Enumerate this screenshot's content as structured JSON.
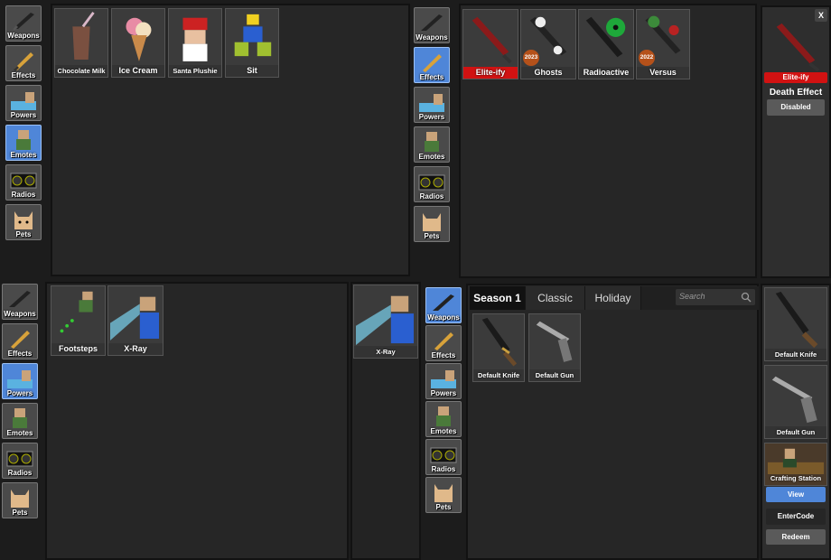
{
  "sidebar_labels": {
    "weapons": "Weapons",
    "effects": "Effects",
    "powers": "Powers",
    "emotes": "Emotes",
    "radios": "Radios",
    "pets": "Pets"
  },
  "emotes_panel": {
    "items": [
      "Chocolate Milk",
      "Ice Cream",
      "Santa Plushie",
      "Sit"
    ]
  },
  "effects_panel": {
    "items": [
      {
        "name": "Elite-ify",
        "badge": ""
      },
      {
        "name": "Ghosts",
        "badge": "2023"
      },
      {
        "name": "Radioactive",
        "badge": ""
      },
      {
        "name": "Versus",
        "badge": "2022"
      }
    ]
  },
  "effect_detail": {
    "close_label": "X",
    "item_name": "Elite-ify",
    "section_title": "Death Effect",
    "toggle_label": "Disabled"
  },
  "powers_panel": {
    "items": [
      "Footsteps",
      "X-Ray"
    ],
    "preview_label": "X-Ray"
  },
  "weapons_panel": {
    "tabs": [
      "Season 1",
      "Classic",
      "Holiday"
    ],
    "active_tab": "Season 1",
    "search_placeholder": "Search",
    "items": [
      "Default Knife",
      "Default Gun"
    ]
  },
  "weapon_detail": {
    "knife_label": "Default Knife",
    "gun_label": "Default Gun",
    "crafting_label": "Crafting Station",
    "view_label": "View",
    "code_label": "EnterCode",
    "redeem_label": "Redeem"
  },
  "colors": {
    "accent_blue": "#4f86d8",
    "accent_red": "#d11212"
  }
}
